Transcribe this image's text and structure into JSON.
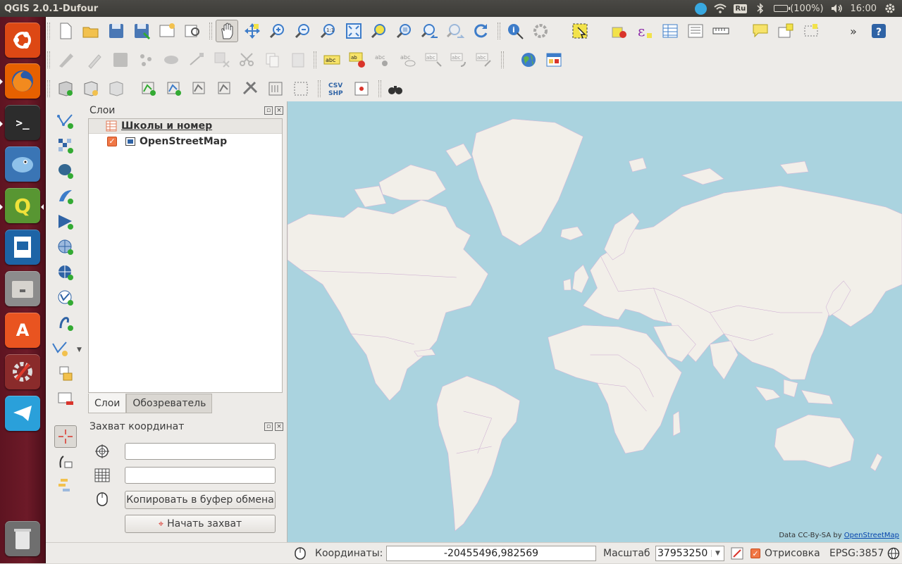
{
  "top_panel": {
    "title": "QGIS 2.0.1-Dufour",
    "keyboard_layout": "Ru",
    "battery": "(100%)",
    "battery_fraction": 1.0,
    "time": "16:00"
  },
  "launcher": {
    "items": [
      {
        "name": "ubuntu-dash",
        "color": "#dd4814"
      },
      {
        "name": "firefox",
        "color": "#e66000"
      },
      {
        "name": "terminal",
        "color": "#2c2c2c"
      },
      {
        "name": "pidgin",
        "color": "#3a75b5"
      },
      {
        "name": "qgis",
        "color": "#589632"
      },
      {
        "name": "libreoffice-impress",
        "color": "#1d64a6"
      },
      {
        "name": "file-manager",
        "color": "#8c8c8c"
      },
      {
        "name": "software-center",
        "color": "#e95420"
      },
      {
        "name": "system-settings",
        "color": "#8a2b2b"
      },
      {
        "name": "telegram",
        "color": "#2aa0da"
      },
      {
        "name": "trash",
        "color": "#6f6f6f"
      }
    ]
  },
  "layers_panel": {
    "title": "Слои",
    "layers": [
      {
        "name": "Школы и номер",
        "type": "group"
      },
      {
        "name": "OpenStreetMap",
        "type": "raster",
        "checked": true
      }
    ],
    "tabs": [
      "Слои",
      "Обозреватель"
    ]
  },
  "coord_panel": {
    "title": "Захват координат",
    "field1_value": "",
    "field2_value": "",
    "copy_button": "Копировать в буфер обмена",
    "start_button": "Начать захват"
  },
  "map": {
    "attribution_prefix": "Data CC-By-SA by ",
    "attribution_link": "OpenStreetMap",
    "ocean_color": "#aad3df",
    "land_color": "#f2efe9"
  },
  "statusbar": {
    "coords_label": "Координаты:",
    "coords_value": "-20455496,982569",
    "scale_label": "Масштаб",
    "scale_value": "37953250",
    "render_label": "Отрисовка",
    "render_checked": true,
    "crs": "EPSG:3857"
  }
}
